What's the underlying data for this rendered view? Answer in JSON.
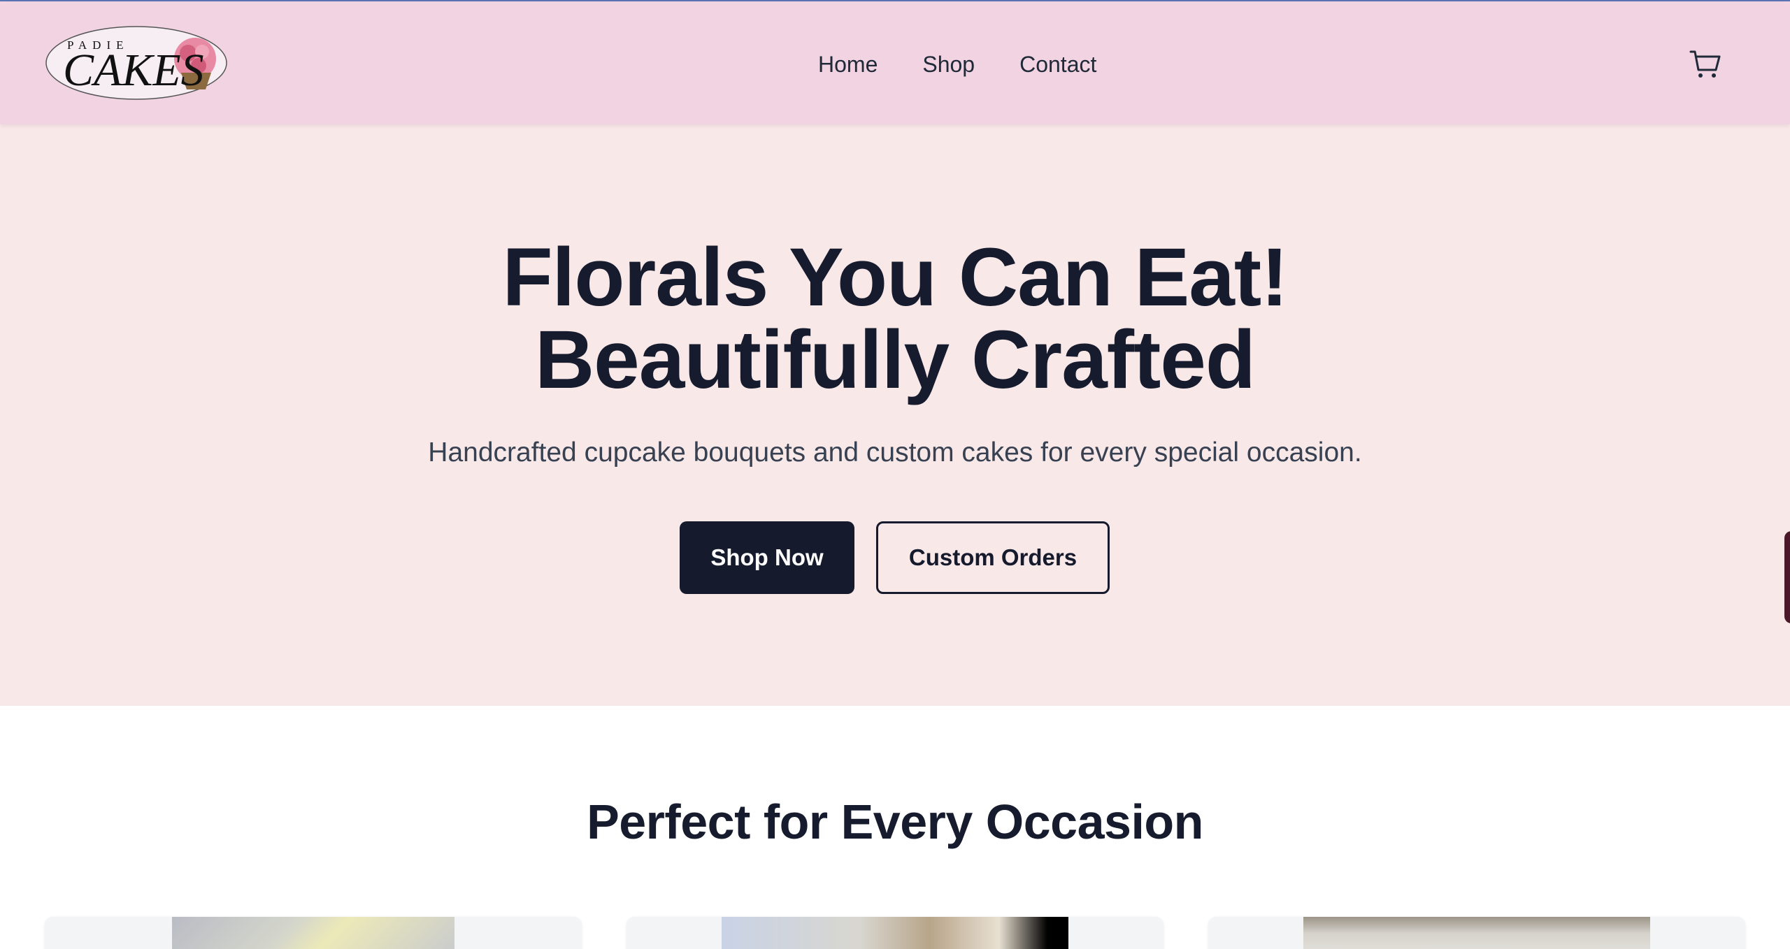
{
  "brand": {
    "logo_small_text": "PADIE",
    "logo_main_text": "CAKES"
  },
  "nav": {
    "items": [
      {
        "label": "Home"
      },
      {
        "label": "Shop"
      },
      {
        "label": "Contact"
      }
    ],
    "cart_icon": "shopping-cart-icon"
  },
  "hero": {
    "title_line1": "Florals You Can Eat!",
    "title_line2": "Beautifully Crafted",
    "subtitle": "Handcrafted cupcake bouquets and custom cakes for every special occasion.",
    "primary_button": "Shop Now",
    "secondary_button": "Custom Orders"
  },
  "occasions": {
    "heading": "Perfect for Every Occasion"
  },
  "colors": {
    "header_bg": "#f1d3e1",
    "hero_bg": "#f9e8e8",
    "primary_dark": "#151a2d",
    "text_dark": "#161b2e"
  }
}
